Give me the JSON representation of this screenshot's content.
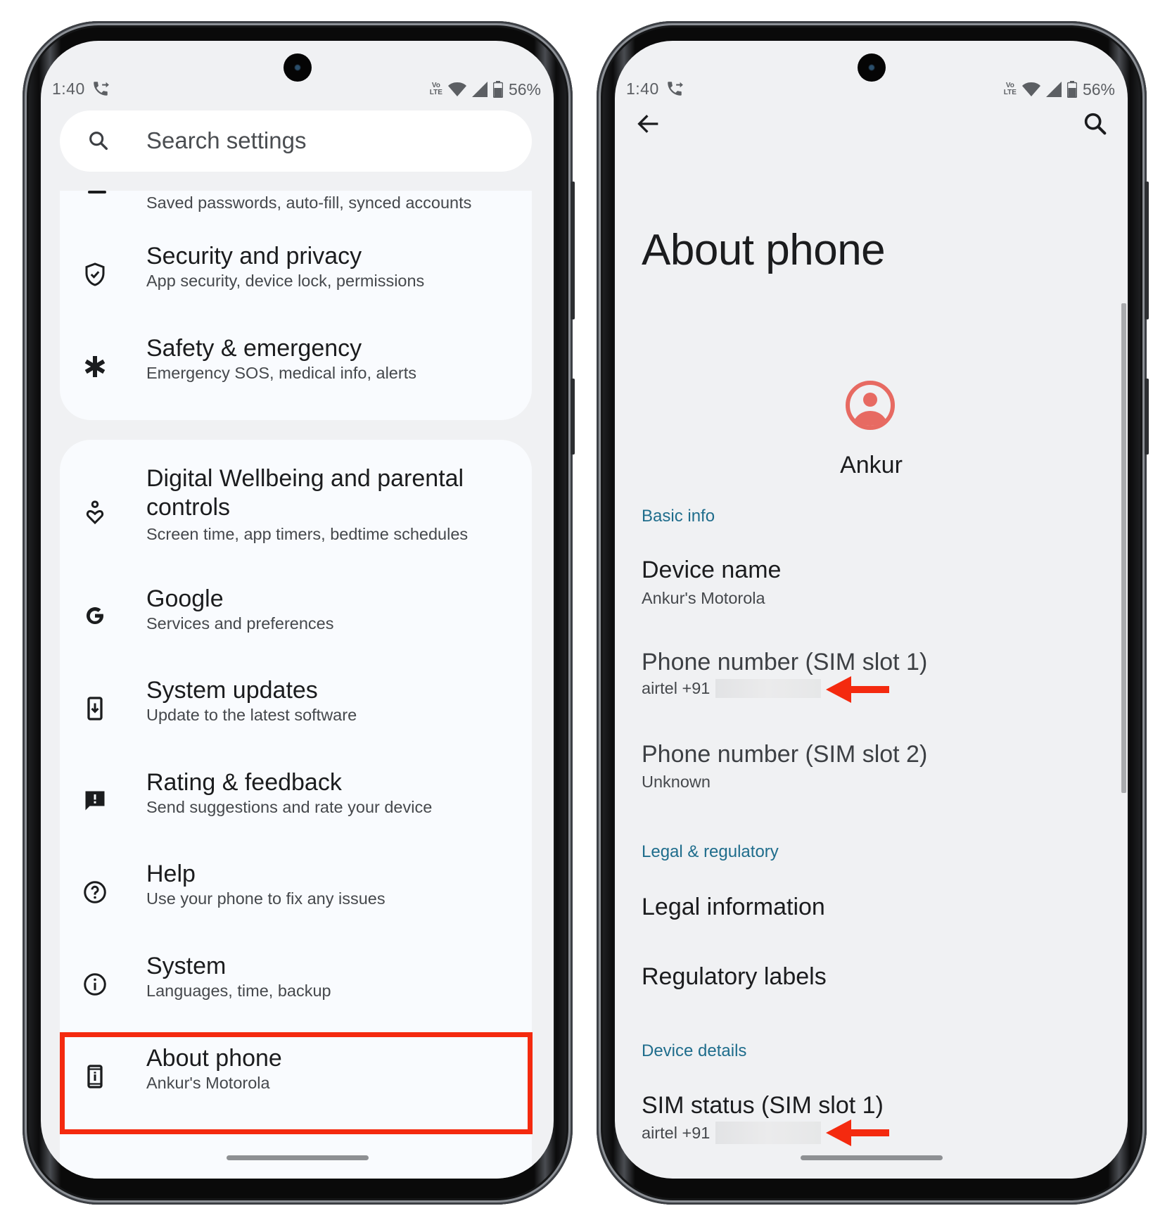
{
  "status_bar": {
    "time": "1:40",
    "call_icon": "call-forward-icon",
    "network_label_top": "Vo",
    "network_label_bottom": "LTE",
    "battery_percent": "56%"
  },
  "left_screen": {
    "search": {
      "placeholder": "Search settings"
    },
    "items": [
      {
        "id": "passwords",
        "icon": "passwords-icon",
        "title": "",
        "subtitle": "Saved passwords, auto-fill, synced accounts"
      },
      {
        "id": "security",
        "icon": "shield-check-icon",
        "title": "Security and privacy",
        "subtitle": "App security, device lock, permissions"
      },
      {
        "id": "safety",
        "icon": "asterisk-icon",
        "title": "Safety & emergency",
        "subtitle": "Emergency SOS, medical info, alerts"
      },
      {
        "id": "wellbeing",
        "icon": "wellbeing-icon",
        "title_line1": "Digital Wellbeing and parental",
        "title_line2": "controls",
        "subtitle": "Screen time, app timers, bedtime schedules"
      },
      {
        "id": "google",
        "icon": "google-icon",
        "title": "Google",
        "subtitle": "Services and preferences"
      },
      {
        "id": "system-updates",
        "icon": "system-update-icon",
        "title": "System updates",
        "subtitle": "Update to the latest software"
      },
      {
        "id": "rating",
        "icon": "feedback-icon",
        "title": "Rating & feedback",
        "subtitle": "Send suggestions and rate your device"
      },
      {
        "id": "help",
        "icon": "help-icon",
        "title": "Help",
        "subtitle": "Use your phone to fix any issues"
      },
      {
        "id": "system",
        "icon": "info-icon",
        "title": "System",
        "subtitle": "Languages, time, backup"
      },
      {
        "id": "about",
        "icon": "about-phone-icon",
        "title": "About phone",
        "subtitle": "Ankur's Motorola",
        "highlighted": true
      }
    ],
    "highlight_color": "#f42a0f"
  },
  "right_screen": {
    "title": "About phone",
    "owner_name": "Ankur",
    "avatar_color": "#e76a62",
    "accent_color": "#1f6d8c",
    "sections": [
      {
        "header": "Basic info",
        "items": [
          {
            "title": "Device name",
            "subtitle": "Ankur's Motorola"
          },
          {
            "title": "Phone number (SIM slot 1)",
            "subtitle": "airtel +91",
            "redacted": true,
            "annotated": true
          },
          {
            "title": "Phone number (SIM slot 2)",
            "subtitle": "Unknown"
          }
        ]
      },
      {
        "header": "Legal & regulatory",
        "items": [
          {
            "title": "Legal information"
          },
          {
            "title": "Regulatory labels"
          }
        ]
      },
      {
        "header": "Device details",
        "items": [
          {
            "title": "SIM status (SIM slot 1)",
            "subtitle": "airtel +91",
            "redacted": true,
            "annotated": true
          }
        ]
      }
    ],
    "annotation_color": "#f42a0f"
  }
}
